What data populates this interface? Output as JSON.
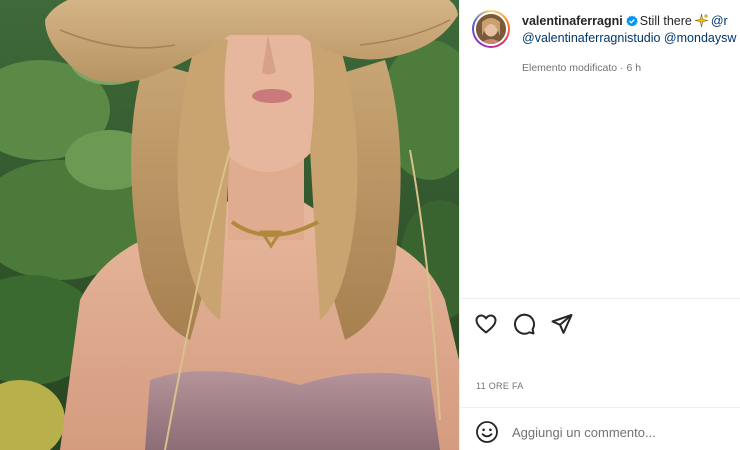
{
  "post": {
    "image_alt": "",
    "author": {
      "username": "valentinaferragni",
      "verified": true
    },
    "caption": {
      "text": "Still there",
      "emoji": "sparkle",
      "mention_partial": "@r",
      "mentions_line2": "@valentinaferragnistudio @mondaysw"
    },
    "edited_label": "Elemento modificato",
    "edited_separator": "·",
    "edited_age": "6 h",
    "timestamp": "11 ORE FA"
  },
  "actions": {
    "like_icon": "heart-icon",
    "comment_icon": "comment-icon",
    "share_icon": "share-icon"
  },
  "comment_box": {
    "placeholder": "Aggiungi un commento...",
    "emoji_icon": "smiley-icon"
  },
  "colors": {
    "accent_link": "#00376b",
    "verified_blue": "#0095f6",
    "text_primary": "#262626",
    "text_secondary": "#737373"
  }
}
